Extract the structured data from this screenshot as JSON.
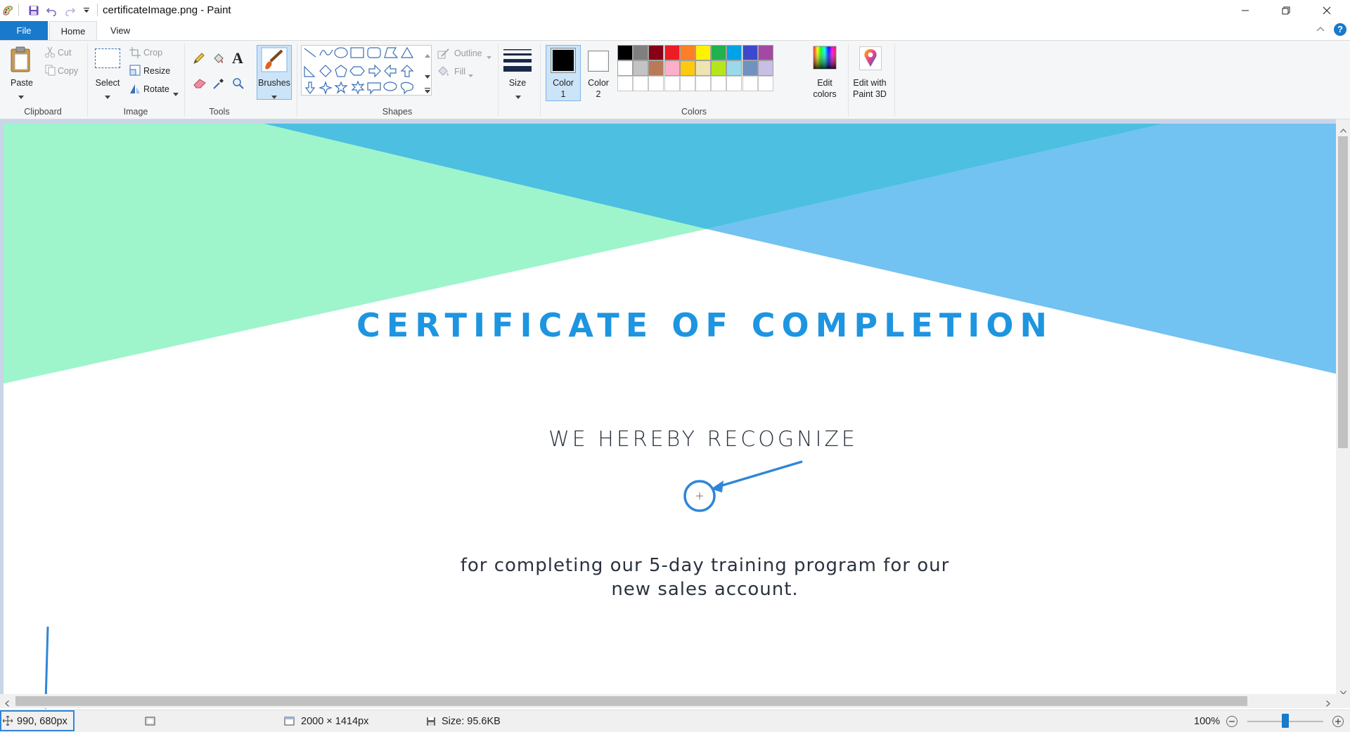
{
  "window": {
    "title": "certificateImage.png - Paint"
  },
  "tabs": {
    "file": "File",
    "home": "Home",
    "view": "View"
  },
  "ribbon": {
    "clipboard": {
      "label": "Clipboard",
      "paste": "Paste",
      "cut": "Cut",
      "copy": "Copy"
    },
    "image": {
      "label": "Image",
      "select": "Select",
      "crop": "Crop",
      "resize": "Resize",
      "rotate": "Rotate"
    },
    "tools": {
      "label": "Tools"
    },
    "brushes": {
      "label": "Brushes"
    },
    "shapes": {
      "label": "Shapes",
      "outline": "Outline",
      "fill": "Fill"
    },
    "size": {
      "label": "Size"
    },
    "colors": {
      "label": "Colors",
      "color1": "Color 1",
      "color1_line1": "Color",
      "color1_line2": "1",
      "color2_line1": "Color",
      "color2_line2": "2",
      "edit_colors_line1": "Edit",
      "edit_colors_line2": "colors",
      "color1_value": "#000000",
      "color2_value": "#ffffff",
      "palette_row1": [
        "#000000",
        "#7f7f7f",
        "#880015",
        "#ed1c24",
        "#ff7f27",
        "#fff200",
        "#22b14c",
        "#00a2e8",
        "#3f48cc",
        "#a349a4"
      ],
      "palette_row2": [
        "#ffffff",
        "#c3c3c3",
        "#b97a57",
        "#ffaec9",
        "#ffc90e",
        "#efe4b0",
        "#b5e61d",
        "#99d9ea",
        "#7092be",
        "#c8bfe7"
      ],
      "palette_row3": [
        "#ffffff",
        "#ffffff",
        "#ffffff",
        "#ffffff",
        "#ffffff",
        "#ffffff",
        "#ffffff",
        "#ffffff",
        "#ffffff",
        "#ffffff"
      ]
    },
    "paint3d": {
      "line1": "Edit with",
      "line2": "Paint 3D"
    }
  },
  "certificate": {
    "heading": "CERTIFICATE OF COMPLETION",
    "recognize": "WE HEREBY RECOGNIZE",
    "body_line1": "for completing our 5-day training program for our",
    "body_line2": "new sales account.",
    "colors": {
      "green": "#9ef5cb",
      "teal": "#4dbfe0",
      "blue": "#72c2f2",
      "heading": "#1e95e0"
    }
  },
  "status": {
    "cursor_pos": "990, 680px",
    "dimensions": "2000 × 1414px",
    "file_size": "Size: 95.6KB",
    "zoom": "100%",
    "zoom_percent": 100
  }
}
